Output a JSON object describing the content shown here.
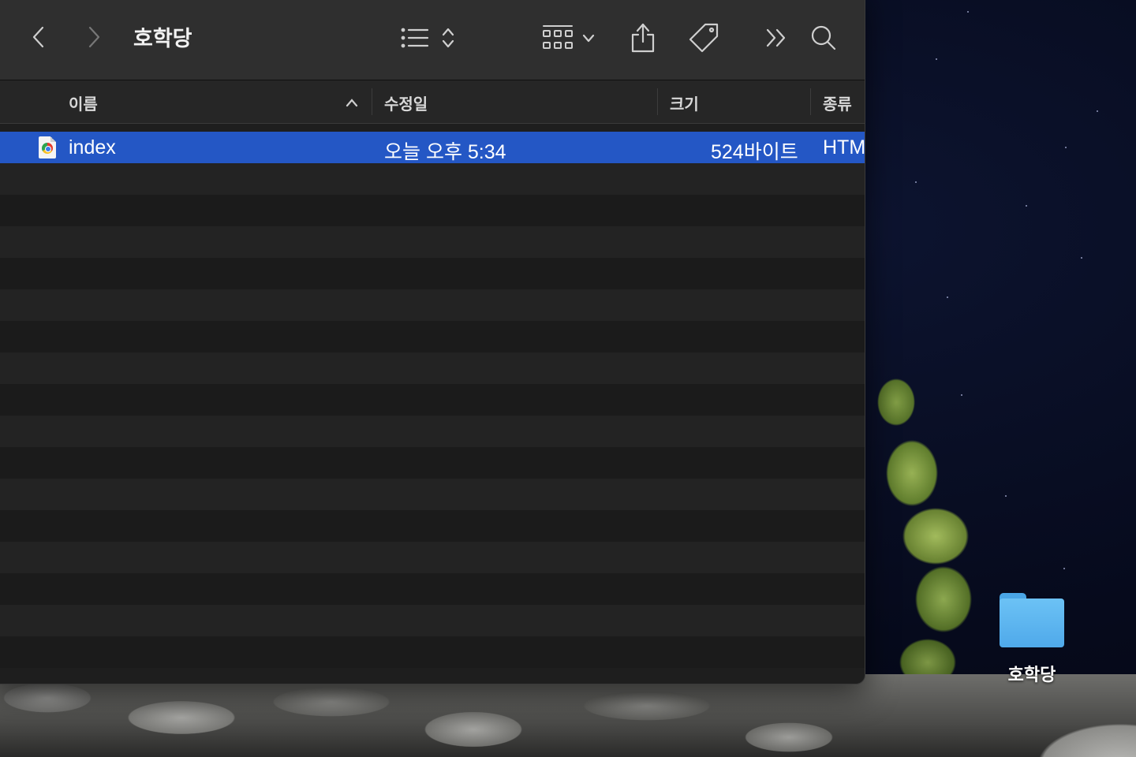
{
  "window": {
    "title": "호학당",
    "toolbar_icons": [
      "chevron-left-icon",
      "chevron-right-icon",
      "list-view-icon",
      "sort-updown-icon",
      "grid-view-icon",
      "chevron-down-icon",
      "share-icon",
      "tag-icon",
      "more-icon",
      "search-icon"
    ]
  },
  "columns": {
    "name": "이름",
    "modified": "수정일",
    "size": "크기",
    "kind": "종류",
    "sort_icon": "chevron-up-icon"
  },
  "files": [
    {
      "name": "index",
      "modified": "오늘 오후 5:34",
      "size": "524바이트",
      "kind": "HTM",
      "icon": "chrome-html-file-icon",
      "selected": true
    }
  ],
  "desktop": {
    "folder_label": "호학당",
    "folder_icon": "folder-icon"
  },
  "colors": {
    "selection": "#2457c5",
    "toolbar": "#2f2f2f",
    "window_bg": "#1e1e1e",
    "folder": "#5fb6ef"
  }
}
